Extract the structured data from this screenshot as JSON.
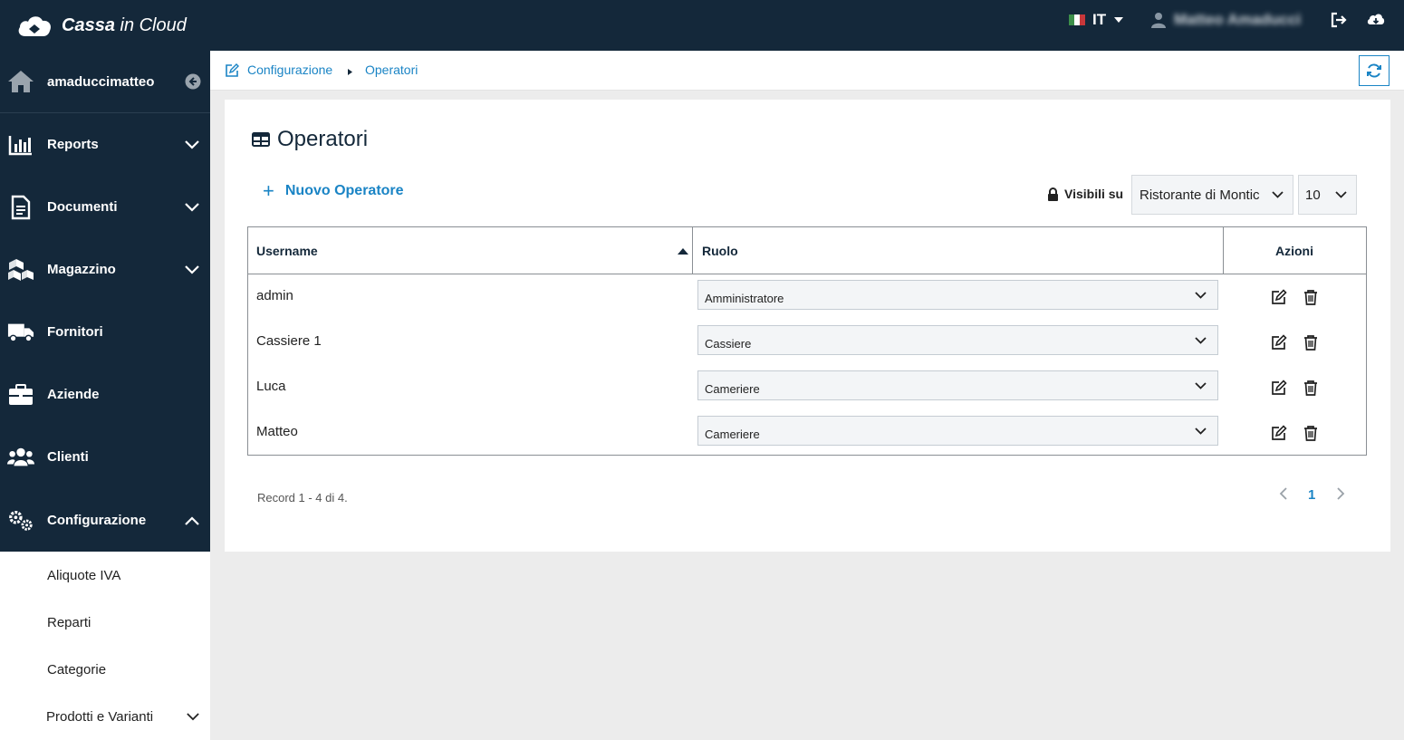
{
  "app": {
    "brand_bold": "Cassa",
    "brand_light": " in Cloud",
    "language": "IT",
    "user_name": "Matteo Amaducci"
  },
  "sidebar": {
    "account": "amaduccimatteo",
    "items": [
      {
        "label": "Reports",
        "icon": "chart-bar-icon"
      },
      {
        "label": "Documenti",
        "icon": "document-icon"
      },
      {
        "label": "Magazzino",
        "icon": "boxes-icon"
      },
      {
        "label": "Fornitori",
        "icon": "truck-icon"
      },
      {
        "label": "Aziende",
        "icon": "briefcase-icon"
      },
      {
        "label": "Clienti",
        "icon": "users-icon"
      },
      {
        "label": "Configurazione",
        "icon": "gears-icon"
      }
    ],
    "subitems": [
      "Aliquote IVA",
      "Reparti",
      "Categorie",
      "Prodotti e Varianti"
    ]
  },
  "breadcrumb": [
    "Configurazione",
    "Operatori"
  ],
  "page": {
    "title": "Operatori",
    "new_button": "Nuovo Operatore",
    "visibility_label": "Visibili su",
    "store_select": "Ristorante di Montic",
    "page_size": "10"
  },
  "table": {
    "headers": {
      "username": "Username",
      "role": "Ruolo",
      "actions": "Azioni"
    },
    "rows": [
      {
        "username": "admin",
        "role": "Amministratore"
      },
      {
        "username": "Cassiere 1",
        "role": "Cassiere"
      },
      {
        "username": "Luca",
        "role": "Cameriere"
      },
      {
        "username": "Matteo",
        "role": "Cameriere"
      }
    ]
  },
  "footer": {
    "record_text": "Record 1 - 4 di 4.",
    "current_page": "1"
  },
  "colors": {
    "navy": "#14283a",
    "accent": "#1a84c5"
  }
}
